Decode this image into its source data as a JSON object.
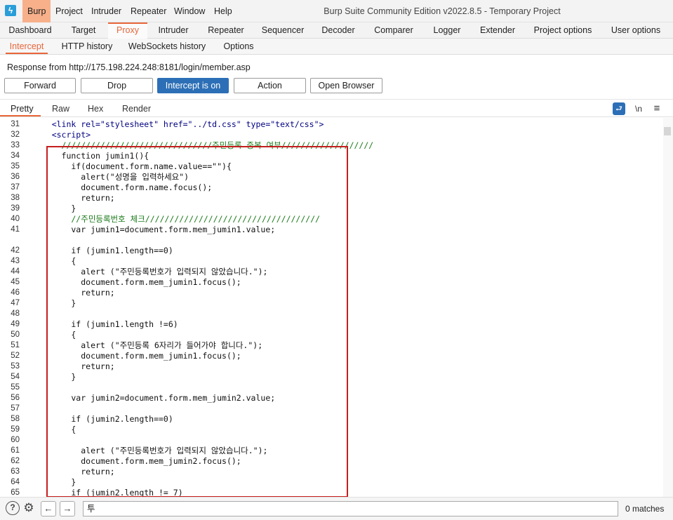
{
  "window": {
    "title": "Burp Suite Community Edition v2022.8.5 - Temporary Project",
    "logo_glyph": "ϟ"
  },
  "menu": [
    "Burp",
    "Project",
    "Intruder",
    "Repeater",
    "Window",
    "Help"
  ],
  "main_tabs": [
    "Dashboard",
    "Target",
    "Proxy",
    "Intruder",
    "Repeater",
    "Sequencer",
    "Decoder",
    "Comparer",
    "Logger",
    "Extender",
    "Project options",
    "User options"
  ],
  "active_main_tab": "Proxy",
  "sub_tabs": [
    "Intercept",
    "HTTP history",
    "WebSockets history",
    "Options"
  ],
  "active_sub_tab": "Intercept",
  "response_info": "Response from http://175.198.224.248:8181/login/member.asp",
  "buttons": {
    "forward": "Forward",
    "drop": "Drop",
    "intercept": "Intercept is on",
    "action": "Action",
    "open_browser": "Open Browser"
  },
  "view_tabs": [
    "Pretty",
    "Raw",
    "Hex",
    "Render"
  ],
  "view_icons": {
    "wrap": "⮐",
    "newline": "\\n",
    "menu": "≡"
  },
  "code_lines": [
    {
      "n": "31",
      "t": "    <link rel=\"stylesheet\" href=\"../td.css\" type=\"text/css\">"
    },
    {
      "n": "32",
      "t": "    <script>"
    },
    {
      "n": "33",
      "t": "      ///////////////////////////////주민등록 중복 여부///////////////////"
    },
    {
      "n": "34",
      "t": "      function jumin1(){"
    },
    {
      "n": "35",
      "t": "        if(document.form.name.value==\"\"){"
    },
    {
      "n": "36",
      "t": "          alert(\"성명을 입력하세요\")"
    },
    {
      "n": "37",
      "t": "          document.form.name.focus();"
    },
    {
      "n": "38",
      "t": "          return;"
    },
    {
      "n": "39",
      "t": "        }"
    },
    {
      "n": "40",
      "t": "        //주민등록번호 체크////////////////////////////////////"
    },
    {
      "n": "41",
      "t": "        var jumin1=document.form.mem_jumin1.value;"
    },
    {
      "n": "",
      "t": ""
    },
    {
      "n": "42",
      "t": "        if (jumin1.length==0)"
    },
    {
      "n": "43",
      "t": "        {"
    },
    {
      "n": "44",
      "t": "          alert (\"주민등록번호가 입력되지 않았습니다.\");"
    },
    {
      "n": "45",
      "t": "          document.form.mem_jumin1.focus();"
    },
    {
      "n": "46",
      "t": "          return;"
    },
    {
      "n": "47",
      "t": "        }"
    },
    {
      "n": "48",
      "t": ""
    },
    {
      "n": "49",
      "t": "        if (jumin1.length !=6)"
    },
    {
      "n": "50",
      "t": "        {"
    },
    {
      "n": "51",
      "t": "          alert (\"주민등록 6자리가 들어가야 합니다.\");"
    },
    {
      "n": "52",
      "t": "          document.form.mem_jumin1.focus();"
    },
    {
      "n": "53",
      "t": "          return;"
    },
    {
      "n": "54",
      "t": "        }"
    },
    {
      "n": "55",
      "t": ""
    },
    {
      "n": "56",
      "t": "        var jumin2=document.form.mem_jumin2.value;"
    },
    {
      "n": "57",
      "t": ""
    },
    {
      "n": "58",
      "t": "        if (jumin2.length==0)"
    },
    {
      "n": "59",
      "t": "        {"
    },
    {
      "n": "60",
      "t": ""
    },
    {
      "n": "61",
      "t": "          alert (\"주민등록번호가 입력되지 않았습니다.\");"
    },
    {
      "n": "62",
      "t": "          document.form.mem_jumin2.focus();"
    },
    {
      "n": "63",
      "t": "          return;"
    },
    {
      "n": "64",
      "t": "        }"
    },
    {
      "n": "65",
      "t": "        if (jumin2.length != 7)"
    }
  ],
  "bottom": {
    "help_icon": "?",
    "settings_icon": "⚙",
    "back_icon": "←",
    "forward_icon": "→",
    "search_value": "투",
    "matches": "0 matches"
  },
  "colors": {
    "accent": "#e8663a",
    "primary_button": "#2c6fb6",
    "highlight_box": "#c41e1e"
  }
}
